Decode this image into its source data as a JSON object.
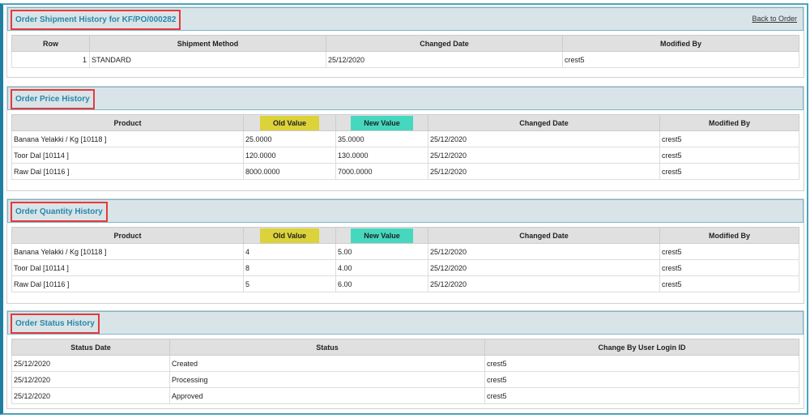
{
  "shipment": {
    "title": "Order Shipment History for KF/PO/000282",
    "back_link": "Back to Order",
    "headers": [
      "Row",
      "Shipment Method",
      "Changed Date",
      "Modified By"
    ],
    "rows": [
      [
        "1",
        "STANDARD",
        "25/12/2020",
        "crest5"
      ]
    ]
  },
  "price": {
    "title": "Order Price History",
    "headers": [
      "Product",
      "Old Value",
      "New Value",
      "Changed Date",
      "Modified By"
    ],
    "rows": [
      [
        "Banana Yelakki / Kg [10118 ]",
        "25.0000",
        "35.0000",
        "25/12/2020",
        "crest5"
      ],
      [
        "Toor Dal [10114 ]",
        "120.0000",
        "130.0000",
        "25/12/2020",
        "crest5"
      ],
      [
        "Raw Dal [10116 ]",
        "8000.0000",
        "7000.0000",
        "25/12/2020",
        "crest5"
      ]
    ]
  },
  "quantity": {
    "title": "Order Quantity History",
    "headers": [
      "Product",
      "Old Value",
      "New Value",
      "Changed Date",
      "Modified By"
    ],
    "rows": [
      [
        "Banana Yelakki / Kg [10118 ]",
        "4",
        "5.00",
        "25/12/2020",
        "crest5"
      ],
      [
        "Toor Dal [10114 ]",
        "8",
        "4.00",
        "25/12/2020",
        "crest5"
      ],
      [
        "Raw Dal [10116 ]",
        "5",
        "6.00",
        "25/12/2020",
        "crest5"
      ]
    ]
  },
  "status": {
    "title": "Order Status History",
    "headers": [
      "Status Date",
      "Status",
      "Change By User Login ID"
    ],
    "rows": [
      [
        "25/12/2020",
        "Created",
        "crest5"
      ],
      [
        "25/12/2020",
        "Processing",
        "crest5"
      ],
      [
        "25/12/2020",
        "Approved",
        "crest5"
      ]
    ]
  }
}
